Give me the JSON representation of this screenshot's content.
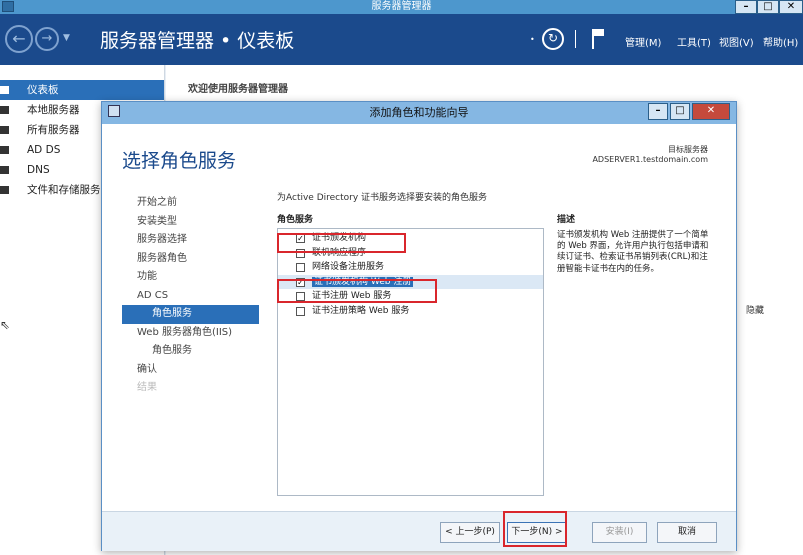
{
  "outer_window": {
    "title": "服务器管理器"
  },
  "header": {
    "breadcrumb_root": "服务器管理器",
    "breadcrumb_sep": "•",
    "breadcrumb_page": "仪表板",
    "menus": [
      "管理(M)",
      "工具(T)",
      "视图(V)",
      "帮助(H)"
    ]
  },
  "leftnav": {
    "items": [
      "仪表板",
      "本地服务器",
      "所有服务器",
      "AD DS",
      "DNS",
      "文件和存储服务"
    ]
  },
  "main": {
    "welcome": "欢迎使用服务器管理器",
    "hide": "隐藏"
  },
  "dialog": {
    "title": "添加角色和功能向导",
    "heading": "选择角色服务",
    "target_label": "目标服务器",
    "target_value": "ADSERVER1.testdomain.com",
    "steps": [
      {
        "label": "开始之前",
        "state": "normal"
      },
      {
        "label": "安装类型",
        "state": "normal"
      },
      {
        "label": "服务器选择",
        "state": "normal"
      },
      {
        "label": "服务器角色",
        "state": "normal"
      },
      {
        "label": "功能",
        "state": "normal"
      },
      {
        "label": "AD CS",
        "state": "normal"
      },
      {
        "label": "角色服务",
        "state": "active"
      },
      {
        "label": "Web 服务器角色(IIS)",
        "state": "normal"
      },
      {
        "label": "角色服务",
        "state": "sub"
      },
      {
        "label": "确认",
        "state": "normal"
      },
      {
        "label": "结果",
        "state": "disabled"
      }
    ],
    "instruction": "为Active Directory 证书服务选择要安装的角色服务",
    "roles_header": "角色服务",
    "desc_header": "描述",
    "roles": [
      {
        "label": "证书颁发机构",
        "checked": true,
        "highlight": false
      },
      {
        "label": "联机响应程序",
        "checked": false,
        "highlight": false
      },
      {
        "label": "网络设备注册服务",
        "checked": false,
        "highlight": false
      },
      {
        "label": "证书颁发机构 Web 注册",
        "checked": true,
        "highlight": true
      },
      {
        "label": "证书注册 Web 服务",
        "checked": false,
        "highlight": false
      },
      {
        "label": "证书注册策略 Web 服务",
        "checked": false,
        "highlight": false
      }
    ],
    "description": "证书颁发机构 Web 注册提供了一个简单的 Web 界面，允许用户执行包括申请和续订证书、检索证书吊销列表(CRL)和注册智能卡证书在内的任务。",
    "buttons": {
      "prev": "< 上一步(P)",
      "next": "下一步(N) >",
      "install": "安装(I)",
      "cancel": "取消"
    }
  }
}
